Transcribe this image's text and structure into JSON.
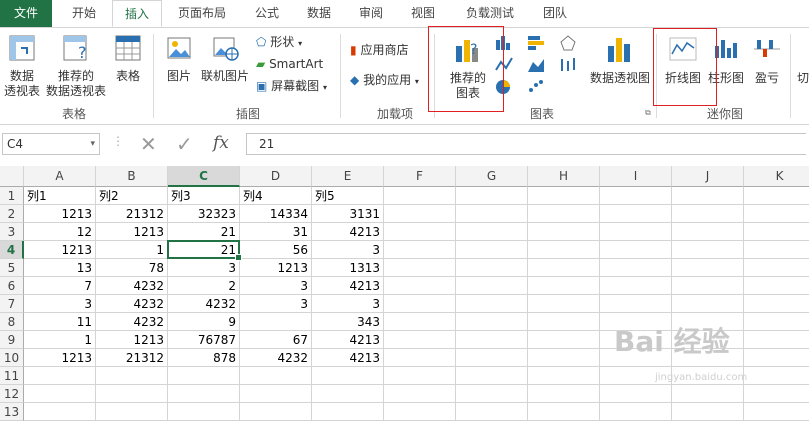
{
  "tabs": [
    "文件",
    "开始",
    "插入",
    "页面布局",
    "公式",
    "数据",
    "审阅",
    "视图",
    "负载测试",
    "团队"
  ],
  "active_tab": "插入",
  "ribbon": {
    "pivot_table": [
      "数据",
      "透视表"
    ],
    "recommended_pivot": [
      "推荐的",
      "数据透视表"
    ],
    "table": "表格",
    "group_tables": "表格",
    "picture": "图片",
    "online_picture": "联机图片",
    "shapes": "形状",
    "smartart": "SmartArt",
    "screenshot": "屏幕截图",
    "group_illustrations": "插图",
    "app_store": "应用商店",
    "my_apps": "我的应用",
    "group_addins": "加载项",
    "recommended_charts": [
      "推荐的",
      "图表"
    ],
    "group_charts": "图表",
    "pivot_chart": "数据透视图",
    "line_sparkline": "折线图",
    "column_sparkline": "柱形图",
    "winloss_sparkline": "盈亏",
    "group_sparklines": "迷你图",
    "cut_label": "切"
  },
  "formula_bar": {
    "name_box": "C4",
    "fx": "fx",
    "value": "21"
  },
  "sheet": {
    "columns": [
      "A",
      "B",
      "C",
      "D",
      "E",
      "F",
      "G",
      "H",
      "I",
      "J",
      "K"
    ],
    "selected_column": "C",
    "selected_row": "4",
    "rows": [
      {
        "num": "1",
        "cells": [
          "列1",
          "列2",
          "列3",
          "列4",
          "列5"
        ]
      },
      {
        "num": "2",
        "cells": [
          "1213",
          "21312",
          "32323",
          "14334",
          "3131"
        ]
      },
      {
        "num": "3",
        "cells": [
          "12",
          "1213",
          "21",
          "31",
          "4213"
        ]
      },
      {
        "num": "4",
        "cells": [
          "1213",
          "1",
          "21",
          "56",
          "3"
        ]
      },
      {
        "num": "5",
        "cells": [
          "13",
          "78",
          "3",
          "1213",
          "1313"
        ]
      },
      {
        "num": "6",
        "cells": [
          "7",
          "4232",
          "2",
          "3",
          "4213"
        ]
      },
      {
        "num": "7",
        "cells": [
          "3",
          "4232",
          "4232",
          "3",
          "3"
        ]
      },
      {
        "num": "8",
        "cells": [
          "11",
          "4232",
          "9",
          "",
          "343"
        ]
      },
      {
        "num": "9",
        "cells": [
          "1",
          "1213",
          "76787",
          "67",
          "4213"
        ]
      },
      {
        "num": "10",
        "cells": [
          "1213",
          "21312",
          "878",
          "4232",
          "4213"
        ]
      },
      {
        "num": "11",
        "cells": [
          "",
          "",
          "",
          "",
          ""
        ]
      },
      {
        "num": "12",
        "cells": [
          "",
          "",
          "",
          "",
          ""
        ]
      },
      {
        "num": "13",
        "cells": [
          "",
          "",
          "",
          "",
          ""
        ]
      }
    ]
  },
  "watermark": "Bai 经验",
  "watermark_url": "jingyan.baidu.com",
  "colors": {
    "excel_green": "#217346",
    "highlight_red": "#e02020"
  }
}
